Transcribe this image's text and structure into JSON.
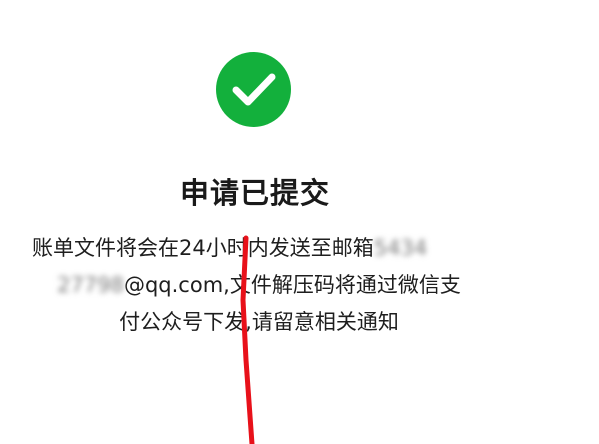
{
  "status": {
    "icon": "check-icon",
    "color": "#13b03c"
  },
  "title": "申请已提交",
  "message": {
    "line1_text": "账单文件将会在24小时内发送至邮箱",
    "email_prefix_a": "5434",
    "email_prefix_b": "27798",
    "email_domain": "@qq.com,",
    "line2_text": "文件解压码将通过微信支",
    "line3_text": "付公众号下发,请留意相关通知"
  },
  "annotation": {
    "color": "#e8111a"
  }
}
